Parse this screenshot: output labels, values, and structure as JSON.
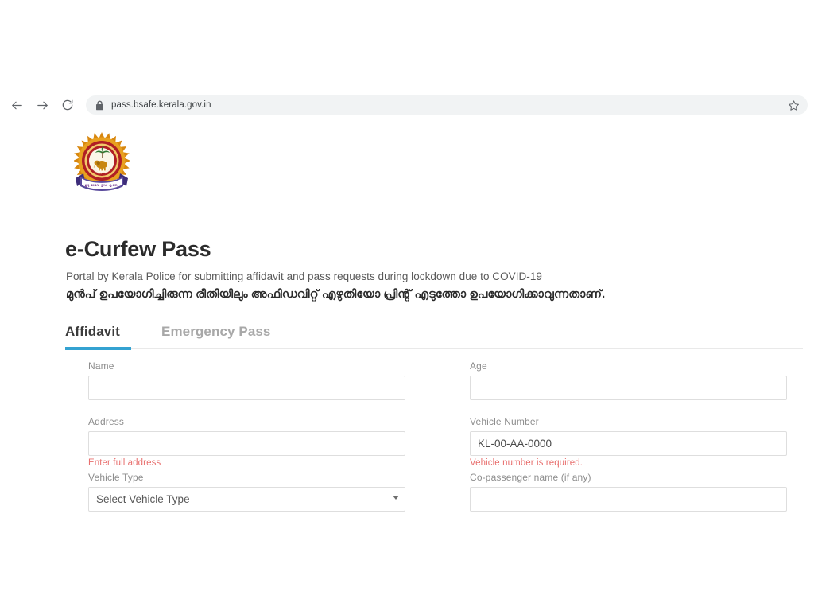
{
  "browser": {
    "back_label": "Back",
    "forward_label": "Forward",
    "reload_label": "Reload",
    "url": "pass.bsafe.kerala.gov.in",
    "lock_icon": "lock-icon",
    "bookmark_icon": "star-icon"
  },
  "site": {
    "logo_alt": "Kerala Police emblem"
  },
  "page": {
    "title": "e-Curfew Pass",
    "subtitle_en": "Portal by Kerala Police for submitting affidavit and pass requests during lockdown due to COVID-19",
    "subtitle_ml": "മുൻപ് ഉപയോഗിച്ചിരുന്ന രീതിയിലും അഫിഡവിറ്റ് എഴുതിയോ പ്രിന്റ് എടുത്തോ ഉപയോഗിക്കാവുന്നതാണ്."
  },
  "tabs": [
    {
      "label": "Affidavit",
      "active": true
    },
    {
      "label": "Emergency Pass",
      "active": false
    }
  ],
  "colors": {
    "accent": "#34a2d1",
    "error": "#e8706f",
    "label": "#8d8d8d",
    "border": "#dedede"
  },
  "form": {
    "fields": {
      "name": {
        "label": "Name",
        "value": "",
        "placeholder": ""
      },
      "age": {
        "label": "Age",
        "value": "",
        "placeholder": ""
      },
      "address": {
        "label": "Address",
        "value": "",
        "placeholder": "",
        "error": "Enter full address"
      },
      "vehicle_number": {
        "label": "Vehicle Number",
        "value": "",
        "placeholder": "KL-00-AA-0000",
        "error": "Vehicle number is required."
      },
      "vehicle_type": {
        "label": "Vehicle Type",
        "selected": "Select Vehicle Type"
      },
      "co_passenger": {
        "label": "Co-passenger name (if any)",
        "value": "",
        "placeholder": ""
      }
    }
  }
}
